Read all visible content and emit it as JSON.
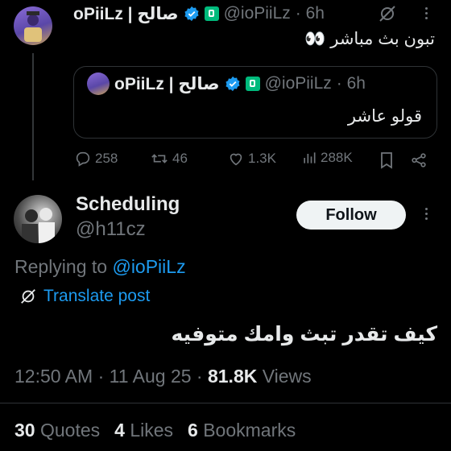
{
  "parent_tweet": {
    "display_name": "oPiiLz | صالح",
    "handle": "@ioPiiLz",
    "time": "· 6h",
    "text": "تبون بث مباشر 👀",
    "quoted": {
      "display_name": "oPiiLz | صالح",
      "handle": "@ioPiiLz",
      "time": "· 6h",
      "text": "قولو عاشر"
    },
    "actions": {
      "replies": "258",
      "reposts": "46",
      "likes": "1.3K",
      "views": "288K"
    }
  },
  "reply": {
    "display_name": "Scheduling",
    "handle": "@h11cz",
    "follow_label": "Follow",
    "replying_prefix": "Replying to",
    "replying_handle": "@ioPiiLz",
    "translate_label": "Translate post",
    "text": "كيف تقدر تبث وامك متوفيه",
    "meta": {
      "time": "12:50 AM",
      "date": "· 11 Aug 25 ·",
      "views_count": "81.8K",
      "views_label": "Views"
    },
    "stats": {
      "quotes_count": "30",
      "quotes_label": "Quotes",
      "likes_count": "4",
      "likes_label": "Likes",
      "bookmarks_count": "6",
      "bookmarks_label": "Bookmarks"
    }
  },
  "colors": {
    "accent": "#1d9bf0",
    "verified": "#1d9bf0",
    "muted": "#71767b",
    "background": "#000000"
  },
  "icons": [
    "grok-icon",
    "more-icon",
    "verified-icon",
    "affiliate-badge-icon",
    "reply-icon",
    "repost-icon",
    "like-icon",
    "views-icon",
    "bookmark-icon",
    "share-icon",
    "translate-icon"
  ]
}
